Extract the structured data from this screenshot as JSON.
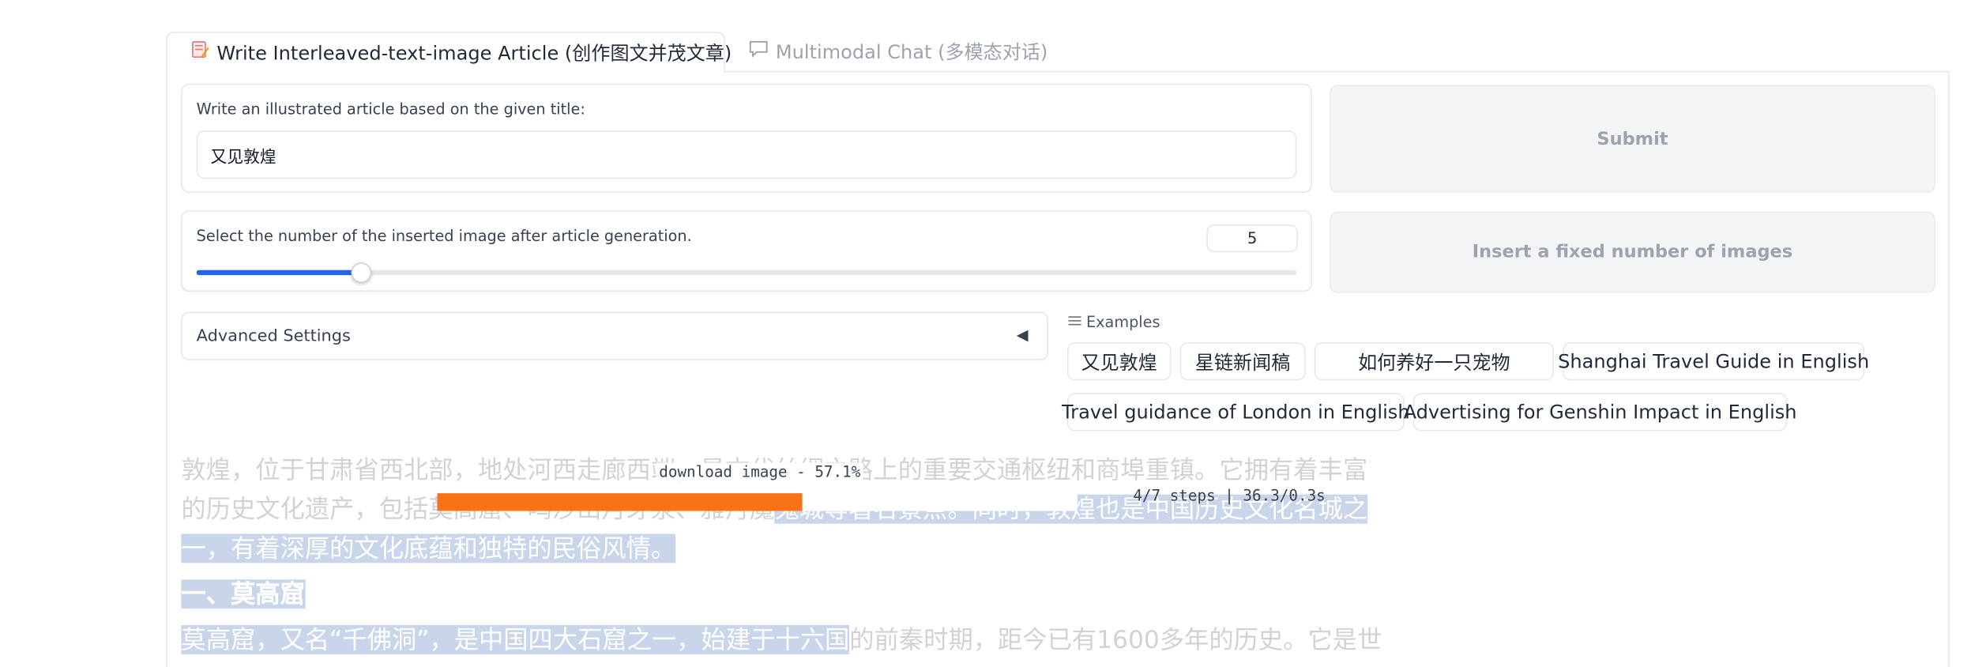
{
  "tabs": {
    "active_label": "Write Interleaved-text-image Article (创作图文并茂文章)",
    "active_icon": "memo-icon",
    "inactive_label": "Multimodal Chat (多模态对话)",
    "inactive_icon": "speech-bubble-icon"
  },
  "title_input": {
    "label": "Write an illustrated article based on the given title:",
    "value": "又见敦煌"
  },
  "image_count": {
    "label": "Select the number of the inserted image after article generation.",
    "value": "5",
    "slider_fraction": 0.15
  },
  "buttons": {
    "submit": "Submit",
    "insert_fixed": "Insert a fixed number of images"
  },
  "advanced": {
    "label": "Advanced Settings",
    "arrow": "◀"
  },
  "examples": {
    "header": "Examples",
    "items": [
      "又见敦煌",
      "星链新闻稿",
      "如何养好一只宠物",
      "Shanghai Travel Guide in English",
      "Travel guidance of London in English",
      "Advertising for Genshin Impact in English"
    ]
  },
  "progress": {
    "download_text": "download image - 57.1%",
    "download_fraction": 0.571,
    "steps_text": "4/7 steps | 36.3/0.3s"
  },
  "article": {
    "line1": "敦煌，位于甘肃省西北部，地处河西走廊西端，是古代丝绸之路上的重要交通枢纽和商埠重镇。它拥有着丰富",
    "line2a": "的历史文化遗产，包括莫高窟、鸣沙山月牙泉、雅丹魔",
    "line2b": "鬼城等著名景点。同时，敦煌也是中国历史文化名城之",
    "line3": "一，有着深厚的文化底蕴和独特的民俗风情。",
    "heading": "一、莫高窟",
    "line5a": "莫高窟，又名“千佛洞”，是中国四大石窟之一，始建于十六国",
    "line5b": "的前秦时期，距今已有1600多年的历史。它是世"
  },
  "colors": {
    "accent": "#2563eb",
    "progress": "#f97316",
    "highlight": "#c9d5ea"
  }
}
